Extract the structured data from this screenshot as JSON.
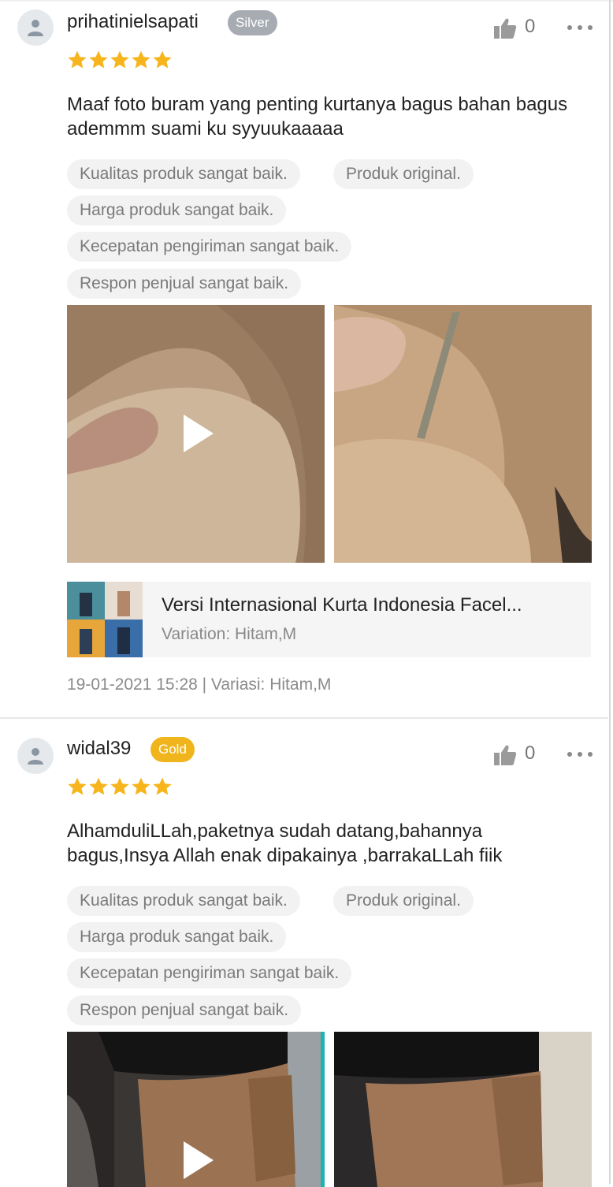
{
  "reviews": [
    {
      "username": "prihatinielsapati",
      "badge": "Silver",
      "likes": "0",
      "rating": 5,
      "comment": "Maaf foto buram yang penting kurtanya bagus bahan bagus ademmm suami ku syyuukaaaaa",
      "tags": [
        "Kualitas produk sangat baik.",
        "Produk original.",
        "Harga produk sangat baik.",
        "Kecepatan pengiriman sangat baik.",
        "Respon penjual sangat baik."
      ],
      "product": {
        "title": "Versi Internasional Kurta Indonesia Facel...",
        "variation": "Variation: Hitam,M"
      },
      "meta": "19-01-2021 15:28 | Variasi: Hitam,M"
    },
    {
      "username": "widal39",
      "badge": "Gold",
      "likes": "0",
      "rating": 5,
      "comment": "AlhamduliLLah,paketnya sudah datang,bahannya bagus,Insya Allah enak dipakainya ,barrakaLLah fiik",
      "tags": [
        "Kualitas produk sangat baik.",
        "Produk original.",
        "Harga produk sangat baik.",
        "Kecepatan pengiriman sangat baik.",
        "Respon penjual sangat baik."
      ]
    }
  ],
  "colors": {
    "star": "#f7b51d",
    "silver_badge": "#a7acb3",
    "gold_badge": "#f0b51c",
    "tag_bg": "#f2f2f2"
  }
}
